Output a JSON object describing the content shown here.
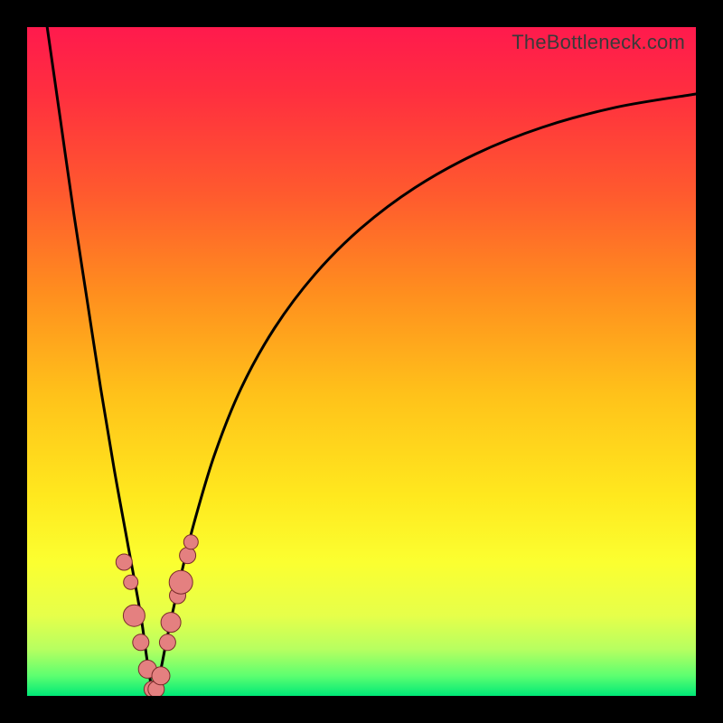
{
  "watermark": "TheBottleneck.com",
  "colors": {
    "frame": "#000000",
    "curve": "#000000",
    "marker_fill": "#e48080",
    "marker_stroke": "#7a2b2b",
    "gradient_stops": [
      {
        "offset": 0.0,
        "color": "#ff1a4d"
      },
      {
        "offset": 0.1,
        "color": "#ff2f3f"
      },
      {
        "offset": 0.25,
        "color": "#ff5a2e"
      },
      {
        "offset": 0.4,
        "color": "#ff8f1e"
      },
      {
        "offset": 0.55,
        "color": "#ffc21a"
      },
      {
        "offset": 0.7,
        "color": "#ffe81e"
      },
      {
        "offset": 0.8,
        "color": "#fbff30"
      },
      {
        "offset": 0.88,
        "color": "#e6ff4a"
      },
      {
        "offset": 0.93,
        "color": "#b7ff60"
      },
      {
        "offset": 0.97,
        "color": "#5dff70"
      },
      {
        "offset": 1.0,
        "color": "#00e877"
      }
    ]
  },
  "chart_data": {
    "type": "line",
    "title": "",
    "xlabel": "",
    "ylabel": "",
    "xlim": [
      0,
      100
    ],
    "ylim": [
      0,
      100
    ],
    "note": "V-shaped bottleneck curve. x is relative component balance; y is bottleneck percentage. Minimum near x≈19 where y≈0. Values estimated from pixels.",
    "series": [
      {
        "name": "bottleneck-curve",
        "x": [
          3,
          5,
          7,
          9,
          11,
          13,
          15,
          17,
          18,
          19,
          20,
          21,
          23,
          25,
          28,
          32,
          37,
          43,
          50,
          58,
          67,
          77,
          88,
          100
        ],
        "y": [
          100,
          86,
          72,
          59,
          46,
          34,
          23,
          12,
          5,
          0,
          4,
          9,
          18,
          26,
          36,
          46,
          55,
          63,
          70,
          76,
          81,
          85,
          88,
          90
        ]
      }
    ],
    "markers": {
      "name": "highlighted-points",
      "x": [
        14.5,
        15.5,
        16.0,
        17.0,
        18.0,
        18.7,
        19.3,
        20.0,
        21.0,
        21.5,
        22.5,
        23.0,
        24.0,
        24.5
      ],
      "y": [
        20,
        17,
        12,
        8,
        4,
        1,
        1,
        3,
        8,
        11,
        15,
        17,
        21,
        23
      ],
      "r": [
        9,
        8,
        12,
        9,
        10,
        9,
        9,
        10,
        9,
        11,
        9,
        13,
        9,
        8
      ]
    }
  }
}
